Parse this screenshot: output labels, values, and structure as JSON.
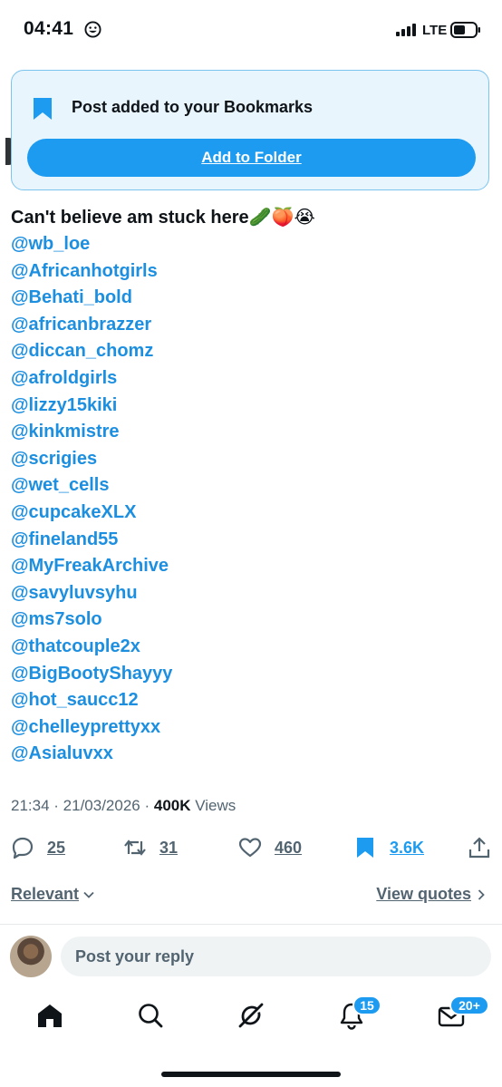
{
  "status_bar": {
    "time": "04:41",
    "network": "LTE",
    "face_icon": "smiley-face-icon"
  },
  "toast": {
    "message": "Post added to your Bookmarks",
    "button_label": "Add to Folder",
    "icon": "bookmark-icon"
  },
  "tweet": {
    "text": "Can't believe am stuck here🥒🍑😭",
    "mentions": [
      "@wb_loe",
      "@Africanhotgirls",
      "@Behati_bold",
      "@africanbrazzer",
      "@diccan_chomz",
      "@afroldgirls",
      "@lizzy15kiki",
      "@kinkmistre",
      "@scrigies",
      "@wet_cells",
      "@cupcakeXLX",
      "@fineland55",
      "@MyFreakArchive",
      "@savyluvsyhu",
      "@ms7solo",
      "@thatcouple2x",
      "@BigBootyShayyy",
      "@hot_saucc12",
      "@chelleyprettyxx",
      "@Asialuvxx"
    ],
    "time": "21:34",
    "date": "21/03/2026",
    "views_count": "400K",
    "views_label": "Views"
  },
  "actions": {
    "replies": "25",
    "reposts": "31",
    "likes": "460",
    "bookmarks": "3.6K"
  },
  "sort": {
    "left_label": "Relevant",
    "right_label": "View quotes"
  },
  "reply": {
    "placeholder": "Post your reply"
  },
  "tabs": {
    "notifications_badge": "15",
    "messages_badge": "20+"
  },
  "colors": {
    "accent": "#1d9bf0",
    "mention": "#1d8fe0",
    "toast_bg": "#e8f5fd",
    "muted": "#536471"
  }
}
